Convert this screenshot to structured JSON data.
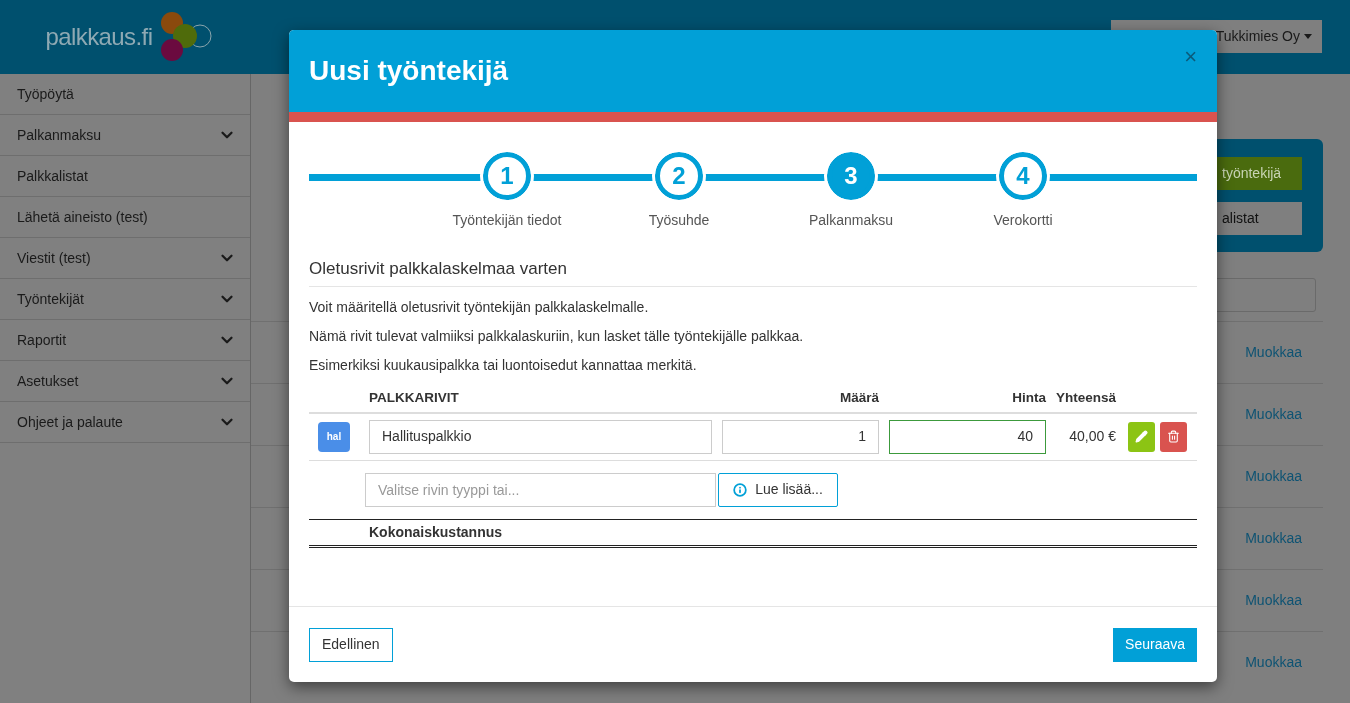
{
  "logo": {
    "text": "palkkaus.fi"
  },
  "sidebar": {
    "items": [
      {
        "label": "Työpöytä",
        "has_submenu": false
      },
      {
        "label": "Palkanmaksu",
        "has_submenu": true
      },
      {
        "label": "Palkkalistat",
        "has_submenu": false
      },
      {
        "label": "Lähetä aineisto (test)",
        "has_submenu": false
      },
      {
        "label": "Viestit (test)",
        "has_submenu": true
      },
      {
        "label": "Työntekijät",
        "has_submenu": true
      },
      {
        "label": "Raportit",
        "has_submenu": true
      },
      {
        "label": "Asetukset",
        "has_submenu": true
      },
      {
        "label": "Ohjeet ja palaute",
        "has_submenu": true
      }
    ]
  },
  "company_menu": {
    "label": "Tukkimies Oy"
  },
  "action_card": {
    "buttons": [
      {
        "label": "työntekijä",
        "kind": "primary"
      },
      {
        "label": "alistat",
        "kind": "default"
      }
    ]
  },
  "list": {
    "rows": [
      {
        "link": "Muokkaa"
      },
      {
        "link": "Muokkaa"
      },
      {
        "link": "Muokkaa"
      },
      {
        "link": "Muokkaa"
      },
      {
        "link": "Muokkaa"
      },
      {
        "link": "Muokkaa"
      }
    ]
  },
  "modal": {
    "title": "Uusi työntekijä",
    "close": "×",
    "steps": [
      {
        "number": "1",
        "label": "Työntekijän tiedot",
        "selected": false
      },
      {
        "number": "2",
        "label": "Työsuhde",
        "selected": false
      },
      {
        "number": "3",
        "label": "Palkanmaksu",
        "selected": true
      },
      {
        "number": "4",
        "label": "Verokortti",
        "selected": false
      }
    ],
    "section_title": "Oletusrivit palkkalaskelmaa varten",
    "paragraphs": [
      "Voit määritellä oletusrivit työntekijän palkkalaskelmalle.",
      "Nämä rivit tulevat valmiiksi palkkalaskuriin, kun lasket tälle työntekijälle palkkaa.",
      "Esimerkiksi kuukausipalkka tai luontoisedut kannattaa merkitä."
    ],
    "table": {
      "columns": [
        "PALKKARIVIT",
        "Määrä",
        "Hinta",
        "Yhteensä"
      ],
      "rows": [
        {
          "badge": "hal",
          "name": "Hallituspalkkio",
          "quantity": "1",
          "price": "40",
          "price_focused": true,
          "total": "40,00 €"
        }
      ],
      "add_placeholder": "Valitse rivin tyyppi tai...",
      "info_button": "Lue lisää...",
      "total_label": "Kokonaiskustannus"
    },
    "back_button": "Edellinen",
    "next_button": "Seuraava"
  }
}
